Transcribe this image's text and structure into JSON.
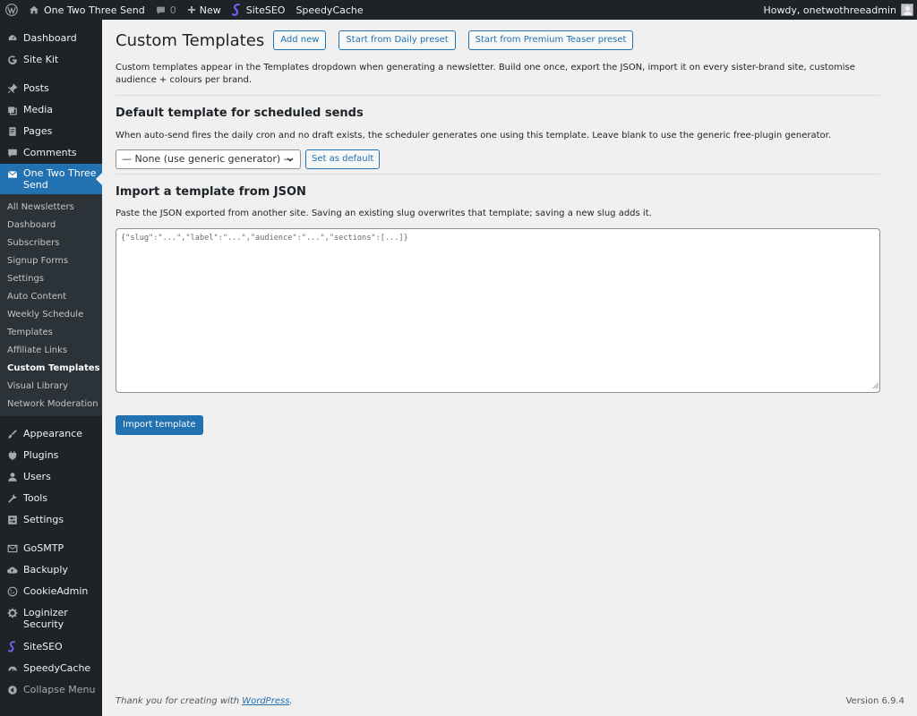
{
  "adminbar": {
    "site_name": "One Two Three Send",
    "comments_count": "0",
    "new_label": "New",
    "siteseo_label": "SiteSEO",
    "speedycache_label": "SpeedyCache",
    "greeting": "Howdy, onetwothreeadmin"
  },
  "sidebar": {
    "top_items": [
      {
        "label": "Dashboard",
        "icon": "dashboard-icon"
      },
      {
        "label": "Site Kit",
        "icon": "google-icon"
      },
      {
        "label": "Posts",
        "icon": "pin-icon"
      },
      {
        "label": "Media",
        "icon": "media-icon"
      },
      {
        "label": "Pages",
        "icon": "page-icon"
      },
      {
        "label": "Comments",
        "icon": "comment-icon"
      },
      {
        "label": "One Two Three Send",
        "icon": "email-icon"
      }
    ],
    "submenu": [
      "All Newsletters",
      "Dashboard",
      "Subscribers",
      "Signup Forms",
      "Settings",
      "Auto Content",
      "Weekly Schedule",
      "Templates",
      "Affiliate Links",
      "Custom Templates",
      "Visual Library",
      "Network Moderation"
    ],
    "bottom_items": [
      {
        "label": "Appearance",
        "icon": "brush-icon"
      },
      {
        "label": "Plugins",
        "icon": "plugin-icon"
      },
      {
        "label": "Users",
        "icon": "user-icon"
      },
      {
        "label": "Tools",
        "icon": "wrench-icon"
      },
      {
        "label": "Settings",
        "icon": "settings-icon"
      },
      {
        "label": "GoSMTP",
        "icon": "envelope-icon"
      },
      {
        "label": "Backuply",
        "icon": "cloud-icon"
      },
      {
        "label": "CookieAdmin",
        "icon": "cookie-icon"
      },
      {
        "label": "Loginizer Security",
        "icon": "gear-icon"
      },
      {
        "label": "SiteSEO",
        "icon": "siteseo-icon"
      },
      {
        "label": "SpeedyCache",
        "icon": "speedometer-icon"
      }
    ],
    "collapse_label": "Collapse Menu"
  },
  "main": {
    "title": "Custom Templates",
    "buttons": {
      "add_new": "Add new",
      "daily_preset": "Start from Daily preset",
      "teaser_preset": "Start from Premium Teaser preset"
    },
    "intro": "Custom templates appear in the Templates dropdown when generating a newsletter. Build one once, export the JSON, import it on every sister-brand site, customise audience + colours per brand.",
    "default_section": {
      "heading": "Default template for scheduled sends",
      "description": "When auto-send fires the daily cron and no draft exists, the scheduler generates one using this template. Leave blank to use the generic free-plugin generator.",
      "select_value": "— None (use generic generator) —",
      "set_default_label": "Set as default"
    },
    "import_section": {
      "heading": "Import a template from JSON",
      "description": "Paste the JSON exported from another site. Saving an existing slug overwrites that template; saving a new slug adds it.",
      "textarea_placeholder": "{\"slug\":\"...\",\"label\":\"...\",\"audience\":\"...\",\"sections\":[...]}",
      "import_button": "Import template"
    }
  },
  "footer": {
    "thanks_prefix": "Thank you for creating with ",
    "wordpress_link": "WordPress",
    "thanks_suffix": ".",
    "version": "Version 6.9.4"
  },
  "colors": {
    "accent": "#2271b1",
    "sidebar_bg": "#1d2327",
    "submenu_bg": "#2c3338",
    "page_bg": "#f0f0f1"
  }
}
